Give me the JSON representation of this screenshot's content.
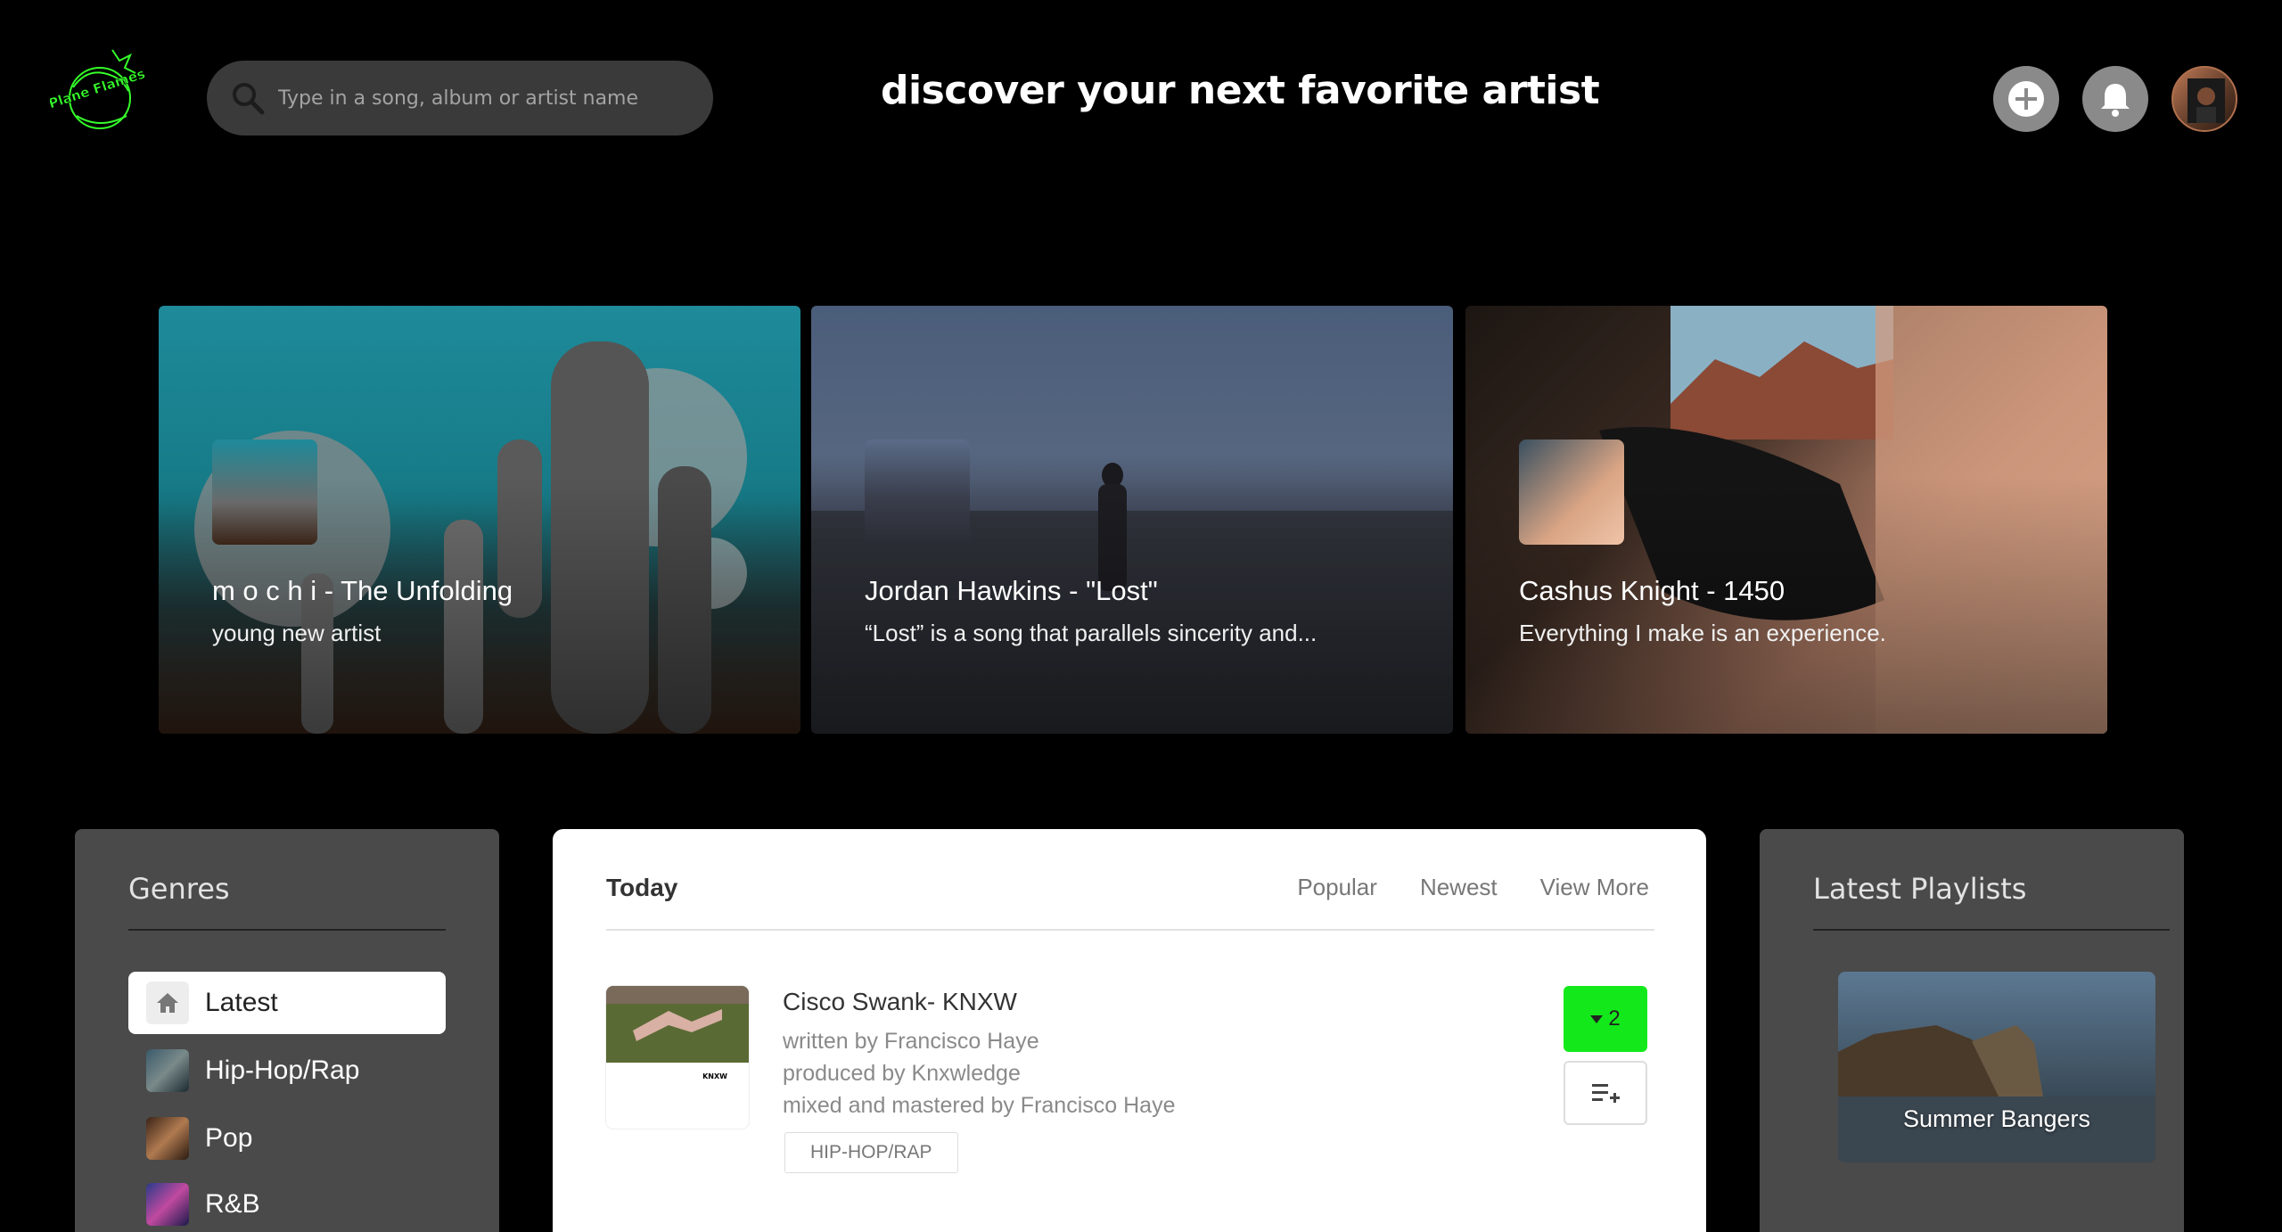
{
  "header": {
    "logo_text": "Plane Flames",
    "search": {
      "placeholder": "Type in a song, album or artist name",
      "value": ""
    },
    "headline": "discover your next favorite artist",
    "icons": [
      "plus-icon",
      "bell-icon",
      "avatar"
    ]
  },
  "featured": [
    {
      "title": "m o c h i - The Unfolding",
      "subtitle": "young new artist"
    },
    {
      "title": "Jordan Hawkins - \"Lost\"",
      "subtitle": "“Lost” is a song that parallels sincerity and..."
    },
    {
      "title": "Cashus Knight - 1450",
      "subtitle": "Everything I make is an experience."
    }
  ],
  "genres": {
    "title": "Genres",
    "items": [
      {
        "label": "Latest",
        "icon": "home-icon",
        "active": true
      },
      {
        "label": "Hip-Hop/Rap",
        "icon": "genre-thumb"
      },
      {
        "label": "Pop",
        "icon": "genre-thumb"
      },
      {
        "label": "R&B",
        "icon": "genre-thumb"
      }
    ]
  },
  "feed": {
    "heading": "Today",
    "tabs": [
      "Popular",
      "Newest",
      "View More"
    ],
    "song": {
      "title": "Cisco Swank- KNXW",
      "written": "written by Francisco Haye",
      "produced": "produced by Knxwledge",
      "mixed": "mixed and mastered by Francisco Haye",
      "tag": "HIP-HOP/RAP",
      "votes": "2",
      "thumb_label": "KNXW"
    }
  },
  "playlists": {
    "title": "Latest Playlists",
    "items": [
      {
        "name": "Summer Bangers"
      }
    ]
  },
  "colors": {
    "accent_green": "#13e91a",
    "panel_gray": "#4a4a4a",
    "bg": "#000000"
  }
}
